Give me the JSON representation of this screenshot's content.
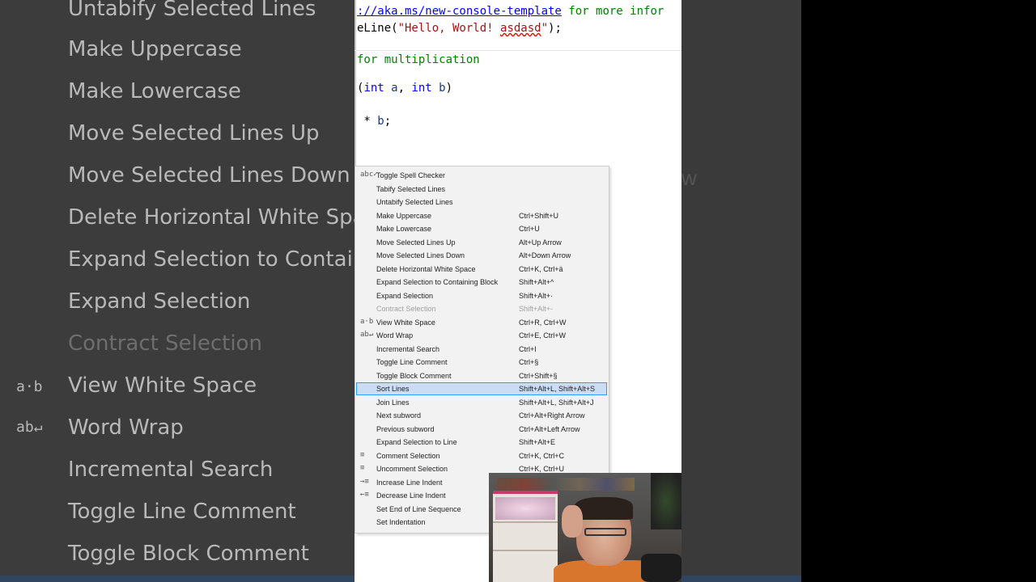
{
  "background_menu": {
    "items": [
      {
        "label": "Untabify Selected Lines",
        "disabled": false
      },
      {
        "label": "Make Uppercase",
        "disabled": false
      },
      {
        "label": "Make Lowercase",
        "disabled": false
      },
      {
        "label": "Move Selected Lines Up",
        "disabled": false
      },
      {
        "label": "Move Selected Lines Down",
        "disabled": false
      },
      {
        "label": "Delete Horizontal White Spac",
        "disabled": false
      },
      {
        "label": "Expand Selection to Containi",
        "disabled": false
      },
      {
        "label": "Expand Selection",
        "disabled": false
      },
      {
        "label": "Contract Selection",
        "disabled": true
      },
      {
        "label": "View White Space",
        "disabled": false
      },
      {
        "label": "Word Wrap",
        "disabled": false
      },
      {
        "label": "Incremental Search",
        "disabled": false
      },
      {
        "label": "Toggle Line Comment",
        "disabled": false
      },
      {
        "label": "Toggle Block Comment",
        "disabled": false
      }
    ],
    "icons": {
      "view_white_space": "a·b",
      "word_wrap": "ab↵"
    },
    "ghost": "w"
  },
  "editor": {
    "line1_link": "://aka.ms/new-console-template",
    "line1_rest": " for more infor",
    "line2_pre": "eLine(",
    "line2_str1": "\"Hello, World! ",
    "line2_squig": "asdasd",
    "line2_str2": "\"",
    "line2_post": ");",
    "line3": "for multiplication",
    "line4_open": "(",
    "line4_kw1": "int",
    "line4_a": " a",
    "line4_comma": ", ",
    "line4_kw2": "int",
    "line4_b": " b",
    "line4_close": ")",
    "line5_star": " * ",
    "line5_b": "b",
    "line5_semi": ";"
  },
  "context_menu": {
    "items": [
      {
        "label": "Toggle Spell Checker",
        "shortcut": "",
        "icon": "abc✓",
        "disabled": false,
        "selected": false
      },
      {
        "label": "Tabify Selected Lines",
        "shortcut": "",
        "icon": "",
        "disabled": false,
        "selected": false
      },
      {
        "label": "Untabify Selected Lines",
        "shortcut": "",
        "icon": "",
        "disabled": false,
        "selected": false
      },
      {
        "label": "Make Uppercase",
        "shortcut": "Ctrl+Shift+U",
        "icon": "",
        "disabled": false,
        "selected": false
      },
      {
        "label": "Make Lowercase",
        "shortcut": "Ctrl+U",
        "icon": "",
        "disabled": false,
        "selected": false
      },
      {
        "label": "Move Selected Lines Up",
        "shortcut": "Alt+Up Arrow",
        "icon": "",
        "disabled": false,
        "selected": false
      },
      {
        "label": "Move Selected Lines Down",
        "shortcut": "Alt+Down Arrow",
        "icon": "",
        "disabled": false,
        "selected": false
      },
      {
        "label": "Delete Horizontal White Space",
        "shortcut": "Ctrl+K, Ctrl+ä",
        "icon": "",
        "disabled": false,
        "selected": false
      },
      {
        "label": "Expand Selection to Containing Block",
        "shortcut": "Shift+Alt+^",
        "icon": "",
        "disabled": false,
        "selected": false
      },
      {
        "label": "Expand Selection",
        "shortcut": "Shift+Alt+·",
        "icon": "",
        "disabled": false,
        "selected": false
      },
      {
        "label": "Contract Selection",
        "shortcut": "Shift+Alt+-",
        "icon": "",
        "disabled": true,
        "selected": false
      },
      {
        "label": "View White Space",
        "shortcut": "Ctrl+R, Ctrl+W",
        "icon": "a·b",
        "disabled": false,
        "selected": false
      },
      {
        "label": "Word Wrap",
        "shortcut": "Ctrl+E, Ctrl+W",
        "icon": "ab↵",
        "disabled": false,
        "selected": false
      },
      {
        "label": "Incremental Search",
        "shortcut": "Ctrl+I",
        "icon": "",
        "disabled": false,
        "selected": false
      },
      {
        "label": "Toggle Line Comment",
        "shortcut": "Ctrl+§",
        "icon": "",
        "disabled": false,
        "selected": false
      },
      {
        "label": "Toggle Block Comment",
        "shortcut": "Ctrl+Shift+§",
        "icon": "",
        "disabled": false,
        "selected": false
      },
      {
        "label": "Sort Lines",
        "shortcut": "Shift+Alt+L, Shift+Alt+S",
        "icon": "",
        "disabled": false,
        "selected": true
      },
      {
        "label": "Join Lines",
        "shortcut": "Shift+Alt+L, Shift+Alt+J",
        "icon": "",
        "disabled": false,
        "selected": false
      },
      {
        "label": "Next subword",
        "shortcut": "Ctrl+Alt+Right Arrow",
        "icon": "",
        "disabled": false,
        "selected": false
      },
      {
        "label": "Previous subword",
        "shortcut": "Ctrl+Alt+Left Arrow",
        "icon": "",
        "disabled": false,
        "selected": false
      },
      {
        "label": "Expand Selection to Line",
        "shortcut": "Shift+Alt+E",
        "icon": "",
        "disabled": false,
        "selected": false
      },
      {
        "label": "Comment Selection",
        "shortcut": "Ctrl+K, Ctrl+C",
        "icon": "≡",
        "disabled": false,
        "selected": false
      },
      {
        "label": "Uncomment Selection",
        "shortcut": "Ctrl+K, Ctrl+U",
        "icon": "≡",
        "disabled": false,
        "selected": false
      },
      {
        "label": "Increase Line Indent",
        "shortcut": "",
        "icon": "→≡",
        "disabled": false,
        "selected": false
      },
      {
        "label": "Decrease Line Indent",
        "shortcut": "",
        "icon": "←≡",
        "disabled": false,
        "selected": false
      },
      {
        "label": "Set End of Line Sequence",
        "shortcut": "",
        "icon": "",
        "disabled": false,
        "selected": false
      },
      {
        "label": "Set Indentation",
        "shortcut": "",
        "icon": "",
        "disabled": false,
        "selected": false
      }
    ]
  },
  "colors": {
    "selection_bg": "#c9def5",
    "selection_border": "#3399ff",
    "menu_bg": "#f2f2f2",
    "comment_green": "#008000",
    "keyword_blue": "#0000ff",
    "string_red": "#a31515"
  }
}
